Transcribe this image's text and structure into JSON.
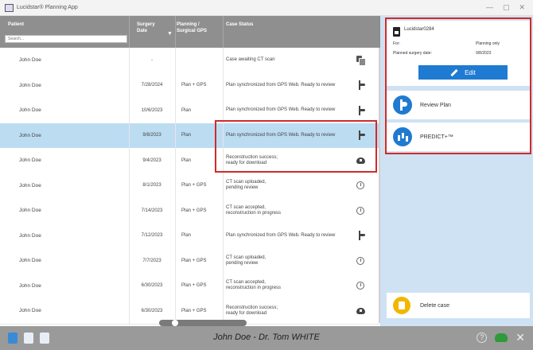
{
  "window": {
    "title": "Lucidstar® Planning App",
    "controls": [
      "—",
      "▢",
      "✕"
    ]
  },
  "table": {
    "headers": {
      "patient": "Patient",
      "patient_placeholder": "Search...",
      "surgery_date": "Surgery\nDate",
      "planning": "Planning /\nSurgical GPS",
      "case_status": "Case Status"
    },
    "rows": [
      {
        "patient": "John Doe",
        "date": "-",
        "plan": "",
        "status": "Case awaiting CT scan",
        "icon": "copy-icon"
      },
      {
        "patient": "John Doe",
        "date": "7/28/2024",
        "plan": "Plan + GPS",
        "status": "Plan synchronized from GPS Web. Ready to review",
        "icon": "plan-icon"
      },
      {
        "patient": "John Doe",
        "date": "10/6/2023",
        "plan": "Plan",
        "status": "Plan synchronized from GPS Web. Ready to review",
        "icon": "plan-icon"
      },
      {
        "patient": "John Doe",
        "date": "9/8/2023",
        "plan": "Plan",
        "status": "Plan synchronized from GPS Web. Ready to review",
        "icon": "plan-icon",
        "selected": true
      },
      {
        "patient": "John Doe",
        "date": "9/4/2023",
        "plan": "Plan",
        "status": "Reconstruction success;\nready for download",
        "icon": "cloud-download-icon"
      },
      {
        "patient": "John Doe",
        "date": "8/1/2023",
        "plan": "Plan + GPS",
        "status": "CT scan uploaded,\npending review",
        "icon": "clock-icon"
      },
      {
        "patient": "John Doe",
        "date": "7/14/2023",
        "plan": "Plan + GPS",
        "status": "CT scan accepted,\nreconstruction in progress",
        "icon": "clock-icon"
      },
      {
        "patient": "John Doe",
        "date": "7/12/2023",
        "plan": "Plan",
        "status": "Plan synchronized from GPS Web. Ready to review",
        "icon": "plan-icon"
      },
      {
        "patient": "John Doe",
        "date": "7/7/2023",
        "plan": "Plan + GPS",
        "status": "CT scan uploaded,\npending review",
        "icon": "clock-icon"
      },
      {
        "patient": "John Doe",
        "date": "6/30/2023",
        "plan": "Plan + GPS",
        "status": "CT scan accepted,\nreconstruction in progress",
        "icon": "clock-icon"
      },
      {
        "patient": "John Doe",
        "date": "6/30/2023",
        "plan": "Plan + GPS",
        "status": "Reconstruction success;\nready for download",
        "icon": "cloud-download-icon"
      }
    ]
  },
  "case_panel": {
    "case_id": "Lucidstar0284",
    "for_label": "For:",
    "for_value": "Planning only",
    "planned_date_label": "Planned surgery date:",
    "planned_date_value": "9/8/2023",
    "edit_label": "Edit"
  },
  "actions": {
    "review_plan": "Review Plan",
    "predict": "PREDICT+™",
    "delete_case": "Delete case"
  },
  "statusbar": {
    "user": "John Doe - Dr. Tom WHITE",
    "help": "?"
  },
  "colors": {
    "accent": "#1f7ad1",
    "selected_row": "#bcdcf2",
    "panel_bg": "#cfe2f3",
    "highlight": "#d12a2a",
    "delete": "#f2b600",
    "sync_ok": "#2f9a3a"
  }
}
